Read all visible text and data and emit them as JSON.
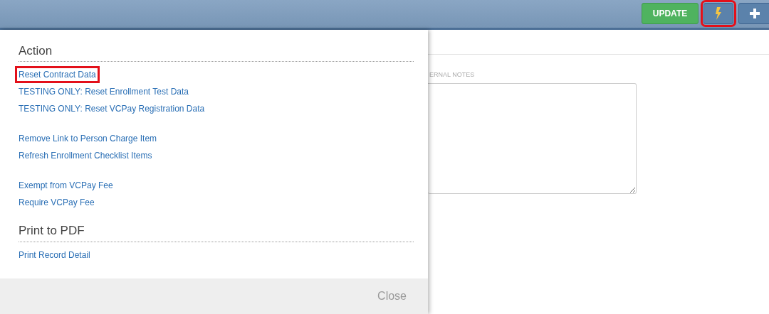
{
  "toolbar": {
    "buttons": [
      {
        "kind": "text",
        "label": "UPDATE",
        "highlighted": false
      },
      {
        "kind": "lightning",
        "highlighted": true
      },
      {
        "kind": "plus",
        "highlighted": false
      }
    ]
  },
  "background_form": {
    "notes_label": "ERNAL NOTES"
  },
  "action_panel": {
    "sections": [
      {
        "heading": "Action",
        "groups": [
          [
            {
              "label": "Reset Contract Data",
              "highlighted": true
            },
            {
              "label": "TESTING ONLY: Reset Enrollment Test Data",
              "highlighted": false
            },
            {
              "label": "TESTING ONLY: Reset VCPay Registration Data",
              "highlighted": false
            }
          ],
          [
            {
              "label": "Remove Link to Person Charge Item",
              "highlighted": false
            },
            {
              "label": "Refresh Enrollment Checklist Items",
              "highlighted": false
            }
          ],
          [
            {
              "label": "Exempt from VCPay Fee",
              "highlighted": false
            },
            {
              "label": "Require VCPay Fee",
              "highlighted": false
            }
          ]
        ]
      },
      {
        "heading": "Print to PDF",
        "groups": [
          [
            {
              "label": "Print Record Detail",
              "highlighted": false
            }
          ]
        ]
      }
    ],
    "close_label": "Close"
  }
}
